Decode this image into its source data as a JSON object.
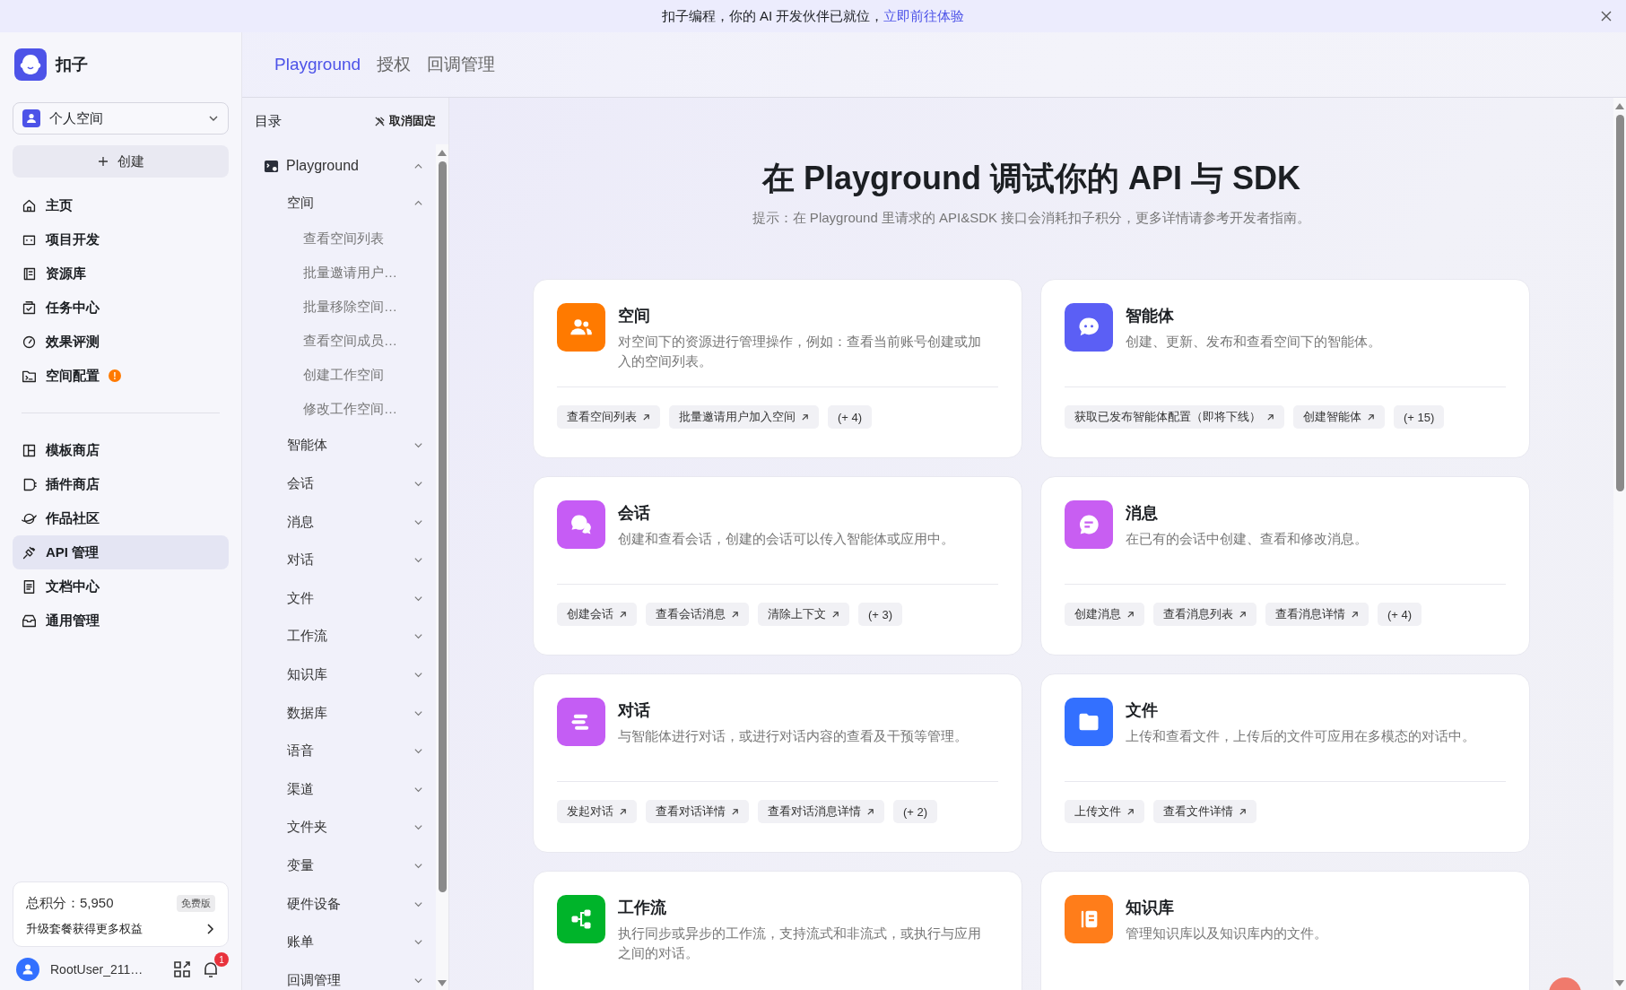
{
  "banner": {
    "text": "扣子编程，你的 AI 开发伙伴已就位，",
    "link": "立即前往体验"
  },
  "sidebar": {
    "brand": "扣子",
    "space": "个人空间",
    "create": "创建",
    "groups": [
      [
        {
          "label": "主页",
          "kind": "home",
          "selected": false
        },
        {
          "label": "项目开发",
          "kind": "bot",
          "selected": false
        },
        {
          "label": "资源库",
          "kind": "library",
          "selected": false
        },
        {
          "label": "任务中心",
          "kind": "task",
          "selected": false
        },
        {
          "label": "效果评测",
          "kind": "gauge",
          "selected": false
        },
        {
          "label": "空间配置",
          "kind": "terminal",
          "selected": false,
          "badge": "!"
        }
      ],
      [
        {
          "label": "模板商店",
          "kind": "template",
          "selected": false
        },
        {
          "label": "插件商店",
          "kind": "plugin",
          "selected": false
        },
        {
          "label": "作品社区",
          "kind": "planet",
          "selected": false
        },
        {
          "label": "API 管理",
          "kind": "plug",
          "selected": true
        },
        {
          "label": "文档中心",
          "kind": "document",
          "selected": false
        },
        {
          "label": "通用管理",
          "kind": "inbox",
          "selected": false
        }
      ]
    ],
    "credits": {
      "label": "总积分：5,950",
      "plan": "免费版",
      "upgrade": "升级套餐获得更多权益"
    },
    "user": {
      "name": "RootUser_211…",
      "notifications": "1"
    }
  },
  "tabs": [
    {
      "label": "Playground",
      "selected": true
    },
    {
      "label": "授权",
      "selected": false
    },
    {
      "label": "回调管理",
      "selected": false
    }
  ],
  "toc": {
    "title": "目录",
    "unpin": "取消固定",
    "tree": [
      {
        "label": "Playground",
        "expanded": true,
        "children": [
          {
            "label": "空间",
            "expanded": true,
            "children": [
              {
                "label": "查看空间列表"
              },
              {
                "label": "批量邀请用户…"
              },
              {
                "label": "批量移除空间…"
              },
              {
                "label": "查看空间成员…"
              },
              {
                "label": "创建工作空间"
              },
              {
                "label": "修改工作空间…"
              }
            ]
          },
          {
            "label": "智能体",
            "expanded": false
          },
          {
            "label": "会话",
            "expanded": false
          },
          {
            "label": "消息",
            "expanded": false
          },
          {
            "label": "对话",
            "expanded": false
          },
          {
            "label": "文件",
            "expanded": false
          },
          {
            "label": "工作流",
            "expanded": false
          },
          {
            "label": "知识库",
            "expanded": false
          },
          {
            "label": "数据库",
            "expanded": false
          },
          {
            "label": "语音",
            "expanded": false
          },
          {
            "label": "渠道",
            "expanded": false
          },
          {
            "label": "文件夹",
            "expanded": false
          },
          {
            "label": "变量",
            "expanded": false
          },
          {
            "label": "硬件设备",
            "expanded": false
          },
          {
            "label": "账单",
            "expanded": false
          },
          {
            "label": "回调管理",
            "expanded": false
          }
        ]
      }
    ]
  },
  "main": {
    "title": "在 Playground 调试你的 API 与 SDK",
    "hint": "提示：在 Playground 里请求的 API&SDK 接口会消耗扣子积分，更多详情请参考开发者指南。",
    "cards": [
      {
        "title": "空间",
        "description": "对空间下的资源进行管理操作，例如：查看当前账号创建或加入的空间列表。",
        "kind": "people",
        "color": "#ff7a00",
        "links": [
          "查看空间列表",
          "批量邀请用户加入空间"
        ],
        "more": "(+ 4)"
      },
      {
        "title": "智能体",
        "description": "创建、更新、发布和查看空间下的智能体。",
        "kind": "bubble",
        "color": "#5b5ff5",
        "links": [
          "获取已发布智能体配置（即将下线）",
          "创建智能体"
        ],
        "more": "(+ 15)"
      },
      {
        "title": "会话",
        "description": "创建和查看会话，创建的会话可以传入智能体或应用中。",
        "kind": "bubbles",
        "color": "#c65cf5",
        "links": [
          "创建会话",
          "查看会话消息",
          "清除上下文"
        ],
        "more": "(+ 3)"
      },
      {
        "title": "消息",
        "description": "在已有的会话中创建、查看和修改消息。",
        "kind": "message",
        "color": "#c85ef2",
        "links": [
          "创建消息",
          "查看消息列表",
          "查看消息详情"
        ],
        "more": "(+ 4)"
      },
      {
        "title": "对话",
        "description": "与智能体进行对话，或进行对话内容的查看及干预等管理。",
        "kind": "bars",
        "color": "#c45df4",
        "links": [
          "发起对话",
          "查看对话详情",
          "查看对话消息详情"
        ],
        "more": "(+ 2)"
      },
      {
        "title": "文件",
        "description": "上传和查看文件，上传后的文件可应用在多模态的对话中。",
        "kind": "folder",
        "color": "#3370ff",
        "links": [
          "上传文件",
          "查看文件详情"
        ]
      },
      {
        "title": "工作流",
        "description": "执行同步或异步的工作流，支持流式和非流式，或执行与应用之间的对话。",
        "kind": "flow",
        "color": "#00b42a"
      },
      {
        "title": "知识库",
        "description": "管理知识库以及知识库内的文件。",
        "kind": "book",
        "color": "#ff7d1a"
      }
    ]
  }
}
